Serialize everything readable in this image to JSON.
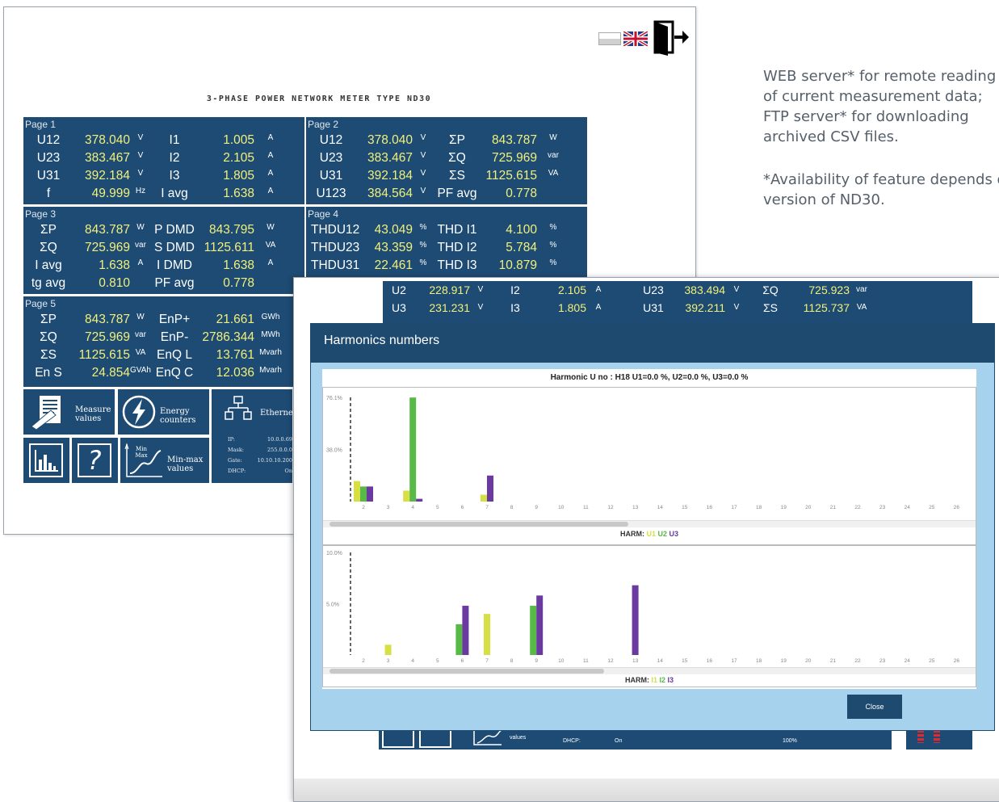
{
  "side_text": {
    "lines": [
      "WEB server* for remote reading",
      "of current measurement data;",
      "FTP server* for downloading",
      "archived CSV files."
    ],
    "note_lines": [
      "*Availability of feature depends o",
      "version of ND30."
    ]
  },
  "meter": {
    "title": "3-PHASE POWER NETWORK METER TYPE ND30",
    "pages": [
      {
        "label": "Page 1",
        "rows": [
          [
            "U12",
            "378.040",
            "V",
            "I1",
            "1.005",
            "A"
          ],
          [
            "U23",
            "383.467",
            "V",
            "I2",
            "2.105",
            "A"
          ],
          [
            "U31",
            "392.184",
            "V",
            "I3",
            "1.805",
            "A"
          ],
          [
            "f",
            "49.999",
            "Hz",
            "I avg",
            "1.638",
            "A"
          ]
        ]
      },
      {
        "label": "Page 2",
        "rows": [
          [
            "U12",
            "378.040",
            "V",
            "ΣP",
            "843.787",
            "W"
          ],
          [
            "U23",
            "383.467",
            "V",
            "ΣQ",
            "725.969",
            "var"
          ],
          [
            "U31",
            "392.184",
            "V",
            "ΣS",
            "1125.615",
            "VA"
          ],
          [
            "U123",
            "384.564",
            "V",
            "PF avg",
            "0.778",
            ""
          ]
        ]
      },
      {
        "label": "Page 3",
        "rows": [
          [
            "ΣP",
            "843.787",
            "W",
            "P DMD",
            "843.795",
            "W"
          ],
          [
            "ΣQ",
            "725.969",
            "var",
            "S DMD",
            "1125.611",
            "VA"
          ],
          [
            "I avg",
            "1.638",
            "A",
            "I DMD",
            "1.638",
            "A"
          ],
          [
            "tg avg",
            "0.810",
            "",
            "PF avg",
            "0.778",
            ""
          ]
        ]
      },
      {
        "label": "Page 4",
        "rows": [
          [
            "THDU12",
            "43.049",
            "%",
            "THD I1",
            "4.100",
            "%"
          ],
          [
            "THDU23",
            "43.359",
            "%",
            "THD I2",
            "5.784",
            "%"
          ],
          [
            "THDU31",
            "22.461",
            "%",
            "THD I3",
            "10.879",
            "%"
          ]
        ]
      },
      {
        "label": "Page 5",
        "rows": [
          [
            "ΣP",
            "843.787",
            "W",
            "EnP+",
            "21.661",
            "GWh"
          ],
          [
            "ΣQ",
            "725.969",
            "var",
            "EnP-",
            "2786.344",
            "MWh"
          ],
          [
            "ΣS",
            "1125.615",
            "VA",
            "EnQ L",
            "13.761",
            "Mvarh"
          ],
          [
            "En S",
            "24.854",
            "GVAh",
            "EnQ C",
            "12.036",
            "Mvarh"
          ]
        ]
      }
    ],
    "nav": {
      "measure": "Measure values",
      "energy": "Energy counters",
      "ethernet": "Ethernet",
      "minmax_small": "Min Max",
      "minmax": "Min-max values",
      "help": "?"
    },
    "network": {
      "ip_label": "IP:",
      "ip": "10.0.0.69",
      "mask_label": "Mask:",
      "mask": "255.0.0.0",
      "gate_label": "Gate:",
      "gate": "10.10.10.200",
      "dhcp_label": "DHCP:",
      "dhcp": "On"
    }
  },
  "bg_rows": [
    [
      "U2",
      "228.917",
      "V",
      "I2",
      "2.105",
      "A",
      "U23",
      "383.494",
      "V",
      "ΣQ",
      "725.923",
      "var"
    ],
    [
      "U3",
      "231.231",
      "V",
      "I3",
      "1.805",
      "A",
      "U31",
      "392.211",
      "V",
      "ΣS",
      "1125.737",
      "VA"
    ]
  ],
  "bg_footer": {
    "values": "values",
    "gate": "Gate: 10.10.10.200",
    "dhcp_label": "DHCP:",
    "dhcp": "On",
    "pct": "100%"
  },
  "dialog": {
    "title": "Harmonics numbers",
    "close_label": "Close",
    "chart_title": "Harmonic U no : H18 U1=0.0 %, U2=0.0 %, U3=0.0 %"
  },
  "colors": {
    "panel": "#1e4b74",
    "u1": "#d6e045",
    "u2": "#58b947",
    "u3": "#6a3aa0",
    "dialog_bg": "#a6d2ee",
    "dialog_header": "#1f4a70",
    "close_btn": "#1f4a70"
  },
  "chart_data": [
    {
      "type": "bar",
      "title": "Harmonic U no : H18 U1=0.0 %, U2=0.0 %, U3=0.0 %",
      "categories": [
        "2",
        "3",
        "4",
        "5",
        "6",
        "7",
        "8",
        "9",
        "10",
        "11",
        "12",
        "13",
        "14",
        "15",
        "16",
        "17",
        "18",
        "19",
        "20",
        "21",
        "22",
        "23",
        "24",
        "25",
        "26",
        "27"
      ],
      "ylim": [
        0,
        76.1
      ],
      "yticks": [
        "76.1%",
        "38.0%"
      ],
      "legend_prefix": "HARM:",
      "legend": [
        "U1",
        "U2",
        "U3"
      ],
      "series": [
        {
          "name": "U1",
          "color": "#d6e045",
          "values": [
            15,
            0,
            8,
            0,
            0,
            5,
            0,
            0,
            0,
            0,
            0,
            0,
            0,
            0,
            0,
            0,
            0,
            0,
            0,
            0,
            0,
            0,
            0,
            0,
            0,
            0
          ]
        },
        {
          "name": "U2",
          "color": "#58b947",
          "values": [
            11,
            0,
            76,
            0,
            0,
            0,
            0,
            0,
            0,
            0,
            0,
            0,
            0,
            0,
            0,
            0,
            0,
            0,
            0,
            0,
            0,
            0,
            0,
            0,
            0,
            0
          ]
        },
        {
          "name": "U3",
          "color": "#6a3aa0",
          "values": [
            11,
            0,
            2,
            0,
            0,
            19,
            0,
            0,
            0,
            0,
            0,
            0,
            0,
            0,
            0,
            0,
            0,
            0,
            0,
            0,
            0,
            0,
            0,
            0,
            0,
            0
          ]
        }
      ]
    },
    {
      "type": "bar",
      "categories": [
        "2",
        "3",
        "4",
        "5",
        "6",
        "7",
        "8",
        "9",
        "10",
        "11",
        "12",
        "13",
        "14",
        "15",
        "16",
        "17",
        "18",
        "19",
        "20",
        "21",
        "22",
        "23",
        "24",
        "25",
        "26",
        "27"
      ],
      "ylim": [
        0,
        10.0
      ],
      "yticks": [
        "10.0%",
        "5.0%"
      ],
      "legend_prefix": "HARM:",
      "legend": [
        "I1",
        "I2",
        "I3"
      ],
      "series": [
        {
          "name": "I1",
          "color": "#d6e045",
          "values": [
            0,
            1.0,
            0,
            0,
            0,
            4.0,
            0,
            0,
            0,
            0,
            0,
            0,
            0,
            0,
            0,
            0,
            0,
            0,
            0,
            0,
            0,
            0,
            0,
            0,
            0,
            0
          ]
        },
        {
          "name": "I2",
          "color": "#58b947",
          "values": [
            0,
            0,
            0,
            0,
            3.0,
            0,
            0,
            4.8,
            0,
            0,
            0,
            0,
            0,
            0,
            0,
            0,
            0,
            0,
            0,
            0,
            0,
            0,
            0,
            0,
            0,
            0
          ]
        },
        {
          "name": "I3",
          "color": "#6a3aa0",
          "values": [
            0,
            0,
            0,
            0,
            4.8,
            0,
            0,
            5.8,
            0,
            0,
            0,
            6.8,
            0,
            0,
            0,
            0,
            0,
            0,
            0,
            0,
            0,
            0,
            0,
            0,
            0,
            0
          ]
        }
      ]
    }
  ]
}
